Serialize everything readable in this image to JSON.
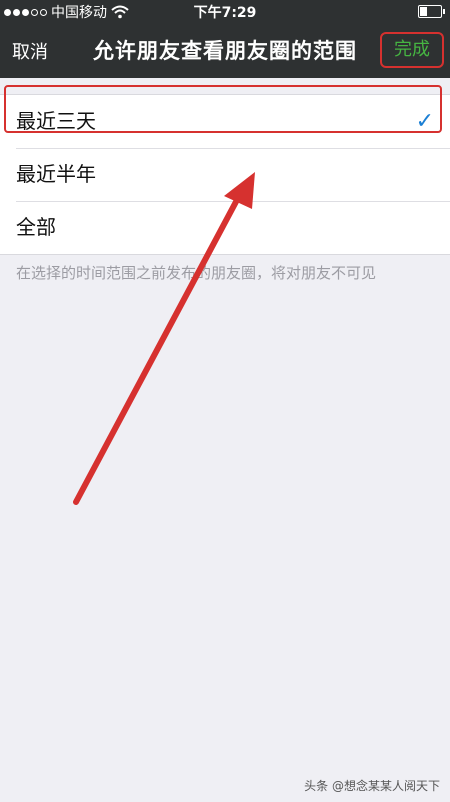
{
  "status_bar": {
    "carrier": "中国移动",
    "time": "下午7:29",
    "signal_filled": 3,
    "signal_total": 5,
    "wifi_icon": "wifi-icon",
    "battery_level": 0.35
  },
  "nav": {
    "cancel_label": "取消",
    "title": "允许朋友查看朋友圈的范围",
    "done_label": "完成"
  },
  "options": [
    {
      "label": "最近三天",
      "selected": true
    },
    {
      "label": "最近半年",
      "selected": false
    },
    {
      "label": "全部",
      "selected": false
    }
  ],
  "checkmark": "✓",
  "note": "在选择的时间范围之前发布的朋友圈，将对朋友不可见",
  "watermark": "头条 @想念某某人阅天下",
  "colors": {
    "bar_bg": "#2e3132",
    "done_text": "#46b442",
    "annotation_red": "#d6312f",
    "check_blue": "#1a7fd4",
    "page_bg": "#efeff4"
  }
}
